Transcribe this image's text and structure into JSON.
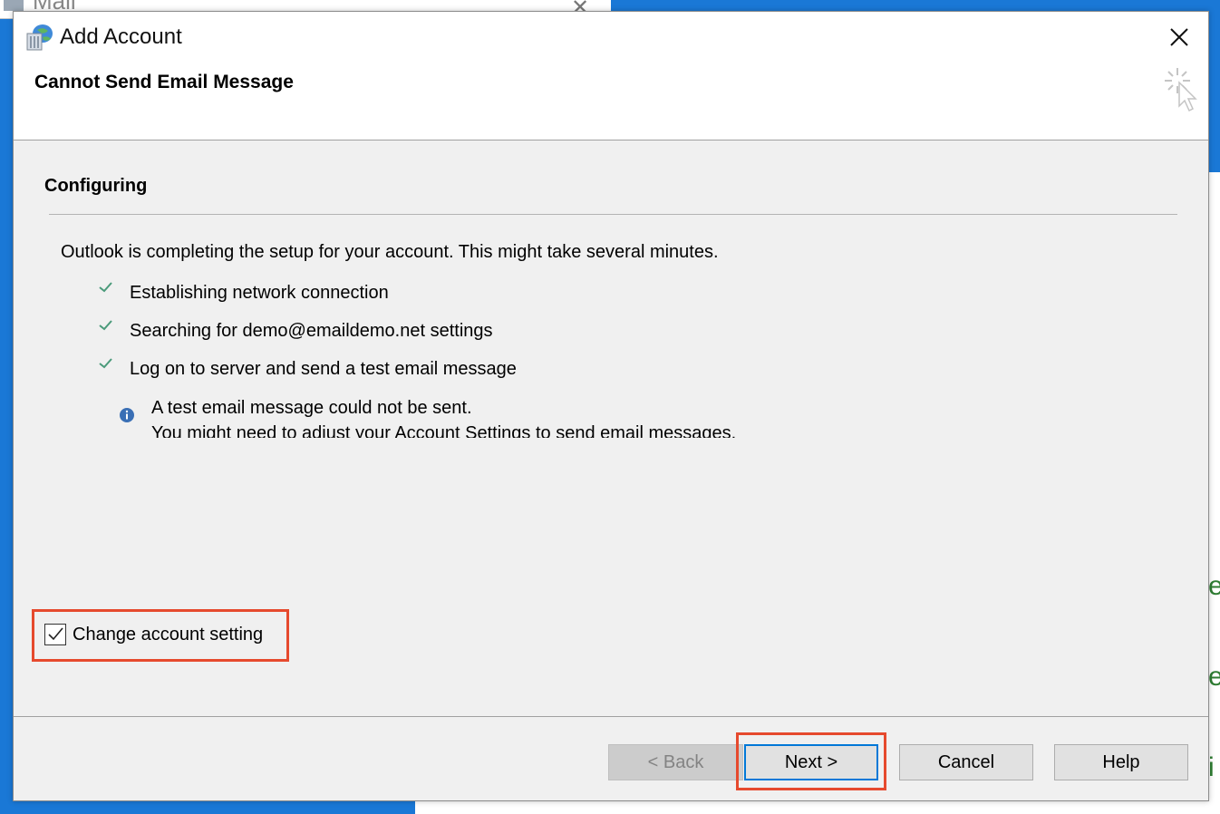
{
  "background": {
    "mail_window_title": "Mail",
    "right_panel_glyphs": [
      "e",
      "e",
      "i"
    ]
  },
  "dialog": {
    "title": "Add Account",
    "page_heading": "Cannot Send Email Message",
    "section_title": "Configuring",
    "intro": "Outlook is completing the setup for your account. This might take several minutes.",
    "steps": [
      {
        "label": "Establishing network connection",
        "status": "done"
      },
      {
        "label": "Searching for demo@emaildemo.net settings",
        "status": "done"
      },
      {
        "label": "Log on to server and send a test email message",
        "status": "done"
      }
    ],
    "info": {
      "line1": "A test email message could not be sent.",
      "line2": "You might need to adjust your Account Settings to send email messages."
    },
    "change_setting": {
      "label": "Change account setting",
      "checked": true
    },
    "buttons": {
      "back": "< Back",
      "next": "Next >",
      "cancel": "Cancel",
      "help": "Help"
    }
  },
  "colors": {
    "accent": "#0078d7",
    "highlight": "#e64a2e",
    "check": "#4a9a7a",
    "info": "#3a6fb5"
  }
}
